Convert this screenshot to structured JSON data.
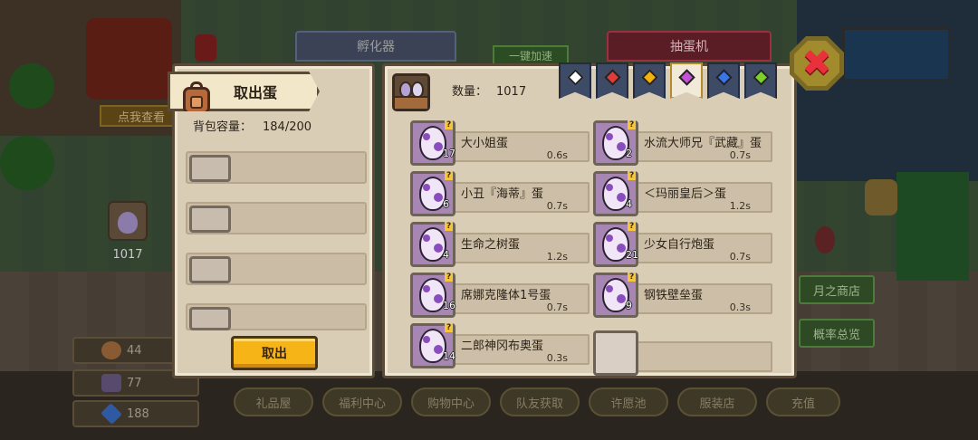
{
  "background": {
    "tabs": {
      "hatcher": "孵化器",
      "gacha": "抽蛋机"
    },
    "speed_up": "一键加速",
    "click_me": "点我查看",
    "egg_counter": "1017",
    "resources": [
      {
        "icon": "orb-icon",
        "value": "44"
      },
      {
        "icon": "portrait-icon",
        "value": "77"
      },
      {
        "icon": "diamond-icon",
        "value": "188"
      }
    ],
    "bottom_nav": [
      "礼品屋",
      "福利中心",
      "购物中心",
      "队友获取",
      "许愿池",
      "服装店",
      "充值"
    ],
    "side_buttons": [
      "月之商店",
      "概率总览"
    ]
  },
  "close_button": {
    "icon": "close-icon",
    "glyph": "✖"
  },
  "left_panel": {
    "title": "取出蛋",
    "capacity_label": "背包容量：",
    "capacity_value": "184/200",
    "slots": 4,
    "takeout_label": "取出"
  },
  "right_panel": {
    "count_label": "数量：",
    "count_value": "1017",
    "filters": [
      {
        "gem_color": "#ffffff",
        "active": false
      },
      {
        "gem_color": "#e53a3a",
        "active": false
      },
      {
        "gem_color": "#f2b10f",
        "active": false
      },
      {
        "gem_color": "#c84fd8",
        "active": true
      },
      {
        "gem_color": "#3b74e6",
        "active": false
      },
      {
        "gem_color": "#7ad12a",
        "active": false
      }
    ],
    "eggs": [
      {
        "name": "大小姐蛋",
        "time": "0.6s",
        "count": "17"
      },
      {
        "name": "水流大师兄『武藏』蛋",
        "time": "0.7s",
        "count": "2"
      },
      {
        "name": "小丑『海蒂』蛋",
        "time": "0.7s",
        "count": "6"
      },
      {
        "name": "＜玛丽皇后＞蛋",
        "time": "1.2s",
        "count": "4"
      },
      {
        "name": "生命之树蛋",
        "time": "1.2s",
        "count": "4"
      },
      {
        "name": "少女自行炮蛋",
        "time": "0.7s",
        "count": "21"
      },
      {
        "name": "席娜克隆体1号蛋",
        "time": "0.7s",
        "count": "16"
      },
      {
        "name": "钢铁壁垒蛋",
        "time": "0.3s",
        "count": "9"
      },
      {
        "name": "二郎神冈布奥蛋",
        "time": "0.3s",
        "count": "14"
      }
    ]
  }
}
